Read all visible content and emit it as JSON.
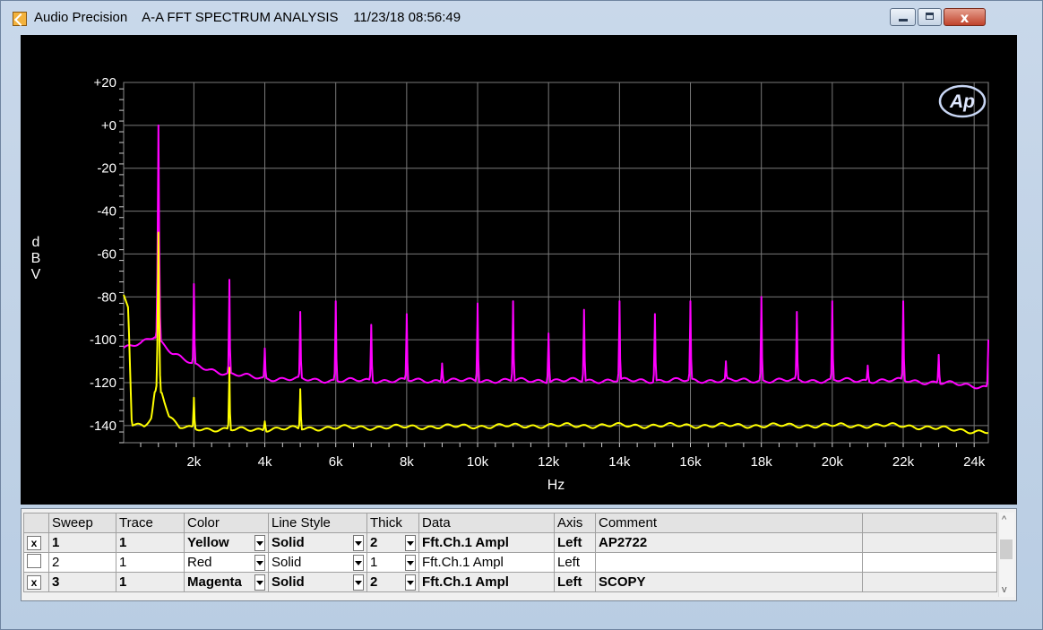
{
  "window": {
    "title": "Audio Precision    A-A FFT SPECTRUM ANALYSIS    11/23/18 08:56:49",
    "close_glyph": "x"
  },
  "chart_data": {
    "type": "line",
    "xlabel": "Hz",
    "ylabel": "dBV",
    "xlim": [
      20,
      24400
    ],
    "ylim": [
      -148,
      20
    ],
    "xticks": [
      2000,
      4000,
      6000,
      8000,
      10000,
      12000,
      14000,
      16000,
      18000,
      20000,
      22000,
      24000
    ],
    "xtick_labels": [
      "2k",
      "4k",
      "6k",
      "8k",
      "10k",
      "12k",
      "14k",
      "16k",
      "18k",
      "20k",
      "22k",
      "24k"
    ],
    "yticks": [
      20,
      0,
      -20,
      -40,
      -60,
      -80,
      -100,
      -120,
      -140
    ],
    "ytick_labels": [
      "+20",
      "+0",
      "-20",
      "-40",
      "-60",
      "-80",
      "-100",
      "-120",
      "-140"
    ],
    "grid": true,
    "logo_text": "Ap",
    "series": [
      {
        "name": "SCOPY",
        "color": "#ff00ff",
        "floor": [
          [
            20,
            -104
          ],
          [
            500,
            -102
          ],
          [
            900,
            -98
          ],
          [
            1400,
            -106
          ],
          [
            2000,
            -112
          ],
          [
            3000,
            -116
          ],
          [
            4000,
            -118
          ],
          [
            6000,
            -119
          ],
          [
            10000,
            -119
          ],
          [
            16000,
            -119
          ],
          [
            20000,
            -119
          ],
          [
            22000,
            -119
          ],
          [
            23000,
            -120
          ],
          [
            24400,
            -122
          ]
        ],
        "peaks": [
          [
            1000,
            0
          ],
          [
            2000,
            -74
          ],
          [
            3000,
            -72
          ],
          [
            4000,
            -104
          ],
          [
            5000,
            -87
          ],
          [
            6000,
            -82
          ],
          [
            7000,
            -93
          ],
          [
            8000,
            -88
          ],
          [
            9000,
            -111
          ],
          [
            10000,
            -83
          ],
          [
            11000,
            -82
          ],
          [
            12000,
            -97
          ],
          [
            13000,
            -86
          ],
          [
            14000,
            -82
          ],
          [
            15000,
            -88
          ],
          [
            16000,
            -82
          ],
          [
            17000,
            -110
          ],
          [
            18000,
            -80
          ],
          [
            19000,
            -87
          ],
          [
            20000,
            -82
          ],
          [
            21000,
            -112
          ],
          [
            22000,
            -82
          ],
          [
            23000,
            -107
          ],
          [
            24400,
            -100
          ]
        ]
      },
      {
        "name": "AP2722",
        "color": "#ffff00",
        "floor": [
          [
            20,
            -80
          ],
          [
            150,
            -85
          ],
          [
            250,
            -140
          ],
          [
            600,
            -140
          ],
          [
            800,
            -136
          ],
          [
            900,
            -124
          ],
          [
            1100,
            -124
          ],
          [
            1300,
            -136
          ],
          [
            1600,
            -141
          ],
          [
            3000,
            -142
          ],
          [
            6000,
            -141
          ],
          [
            12000,
            -140
          ],
          [
            16000,
            -140
          ],
          [
            20000,
            -140
          ],
          [
            22000,
            -140
          ],
          [
            23500,
            -142
          ],
          [
            24400,
            -143
          ]
        ],
        "peaks": [
          [
            1000,
            -50
          ],
          [
            2000,
            -127
          ],
          [
            3000,
            -113
          ],
          [
            4000,
            -138
          ],
          [
            5000,
            -123
          ]
        ]
      }
    ]
  },
  "table": {
    "headers": [
      "Sweep",
      "Trace",
      "Color",
      "Line Style",
      "Thick",
      "Data",
      "Axis",
      "Comment"
    ],
    "rows": [
      {
        "checked": "x",
        "sweep": "1",
        "trace": "1",
        "color": "Yellow",
        "line_style": "Solid",
        "thick": "2",
        "data": "Fft.Ch.1 Ampl",
        "axis": "Left",
        "comment": "AP2722"
      },
      {
        "checked": "",
        "sweep": "2",
        "trace": "1",
        "color": "Red",
        "line_style": "Solid",
        "thick": "1",
        "data": "Fft.Ch.1 Ampl",
        "axis": "Left",
        "comment": ""
      },
      {
        "checked": "x",
        "sweep": "3",
        "trace": "1",
        "color": "Magenta",
        "line_style": "Solid",
        "thick": "2",
        "data": "Fft.Ch.1 Ampl",
        "axis": "Left",
        "comment": "SCOPY"
      }
    ],
    "scroll_up": "^",
    "scroll_down": "v"
  }
}
